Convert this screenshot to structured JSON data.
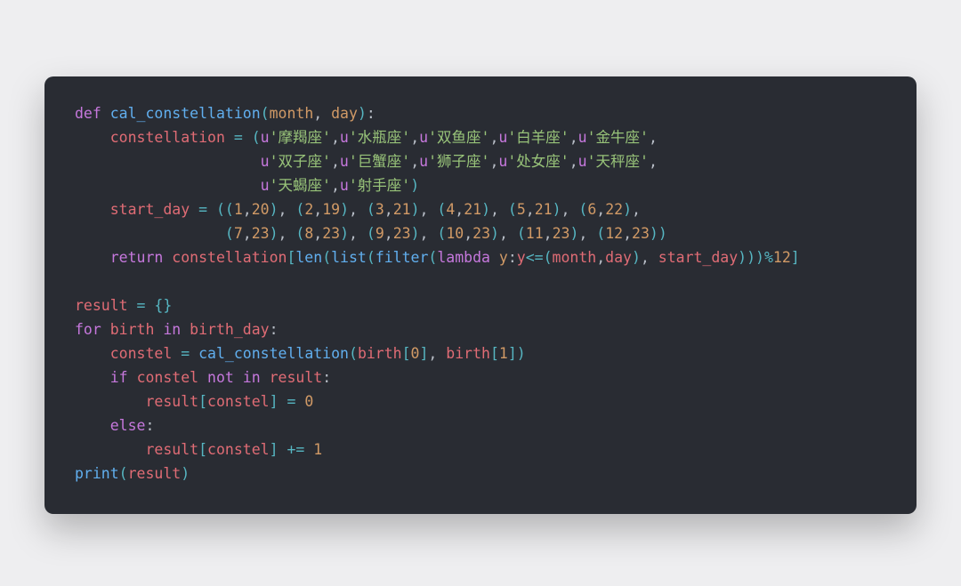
{
  "code": {
    "fn_def": "cal_constellation",
    "param_month": "month",
    "param_day": "day",
    "var_constellation": "constellation",
    "zodiac": [
      "摩羯座",
      "水瓶座",
      "双鱼座",
      "白羊座",
      "金牛座",
      "双子座",
      "巨蟹座",
      "狮子座",
      "处女座",
      "天秤座",
      "天蝎座",
      "射手座"
    ],
    "var_start_day": "start_day",
    "start_day_line1": [
      [
        1,
        20
      ],
      [
        2,
        19
      ],
      [
        3,
        21
      ],
      [
        4,
        21
      ],
      [
        5,
        21
      ],
      [
        6,
        22
      ]
    ],
    "start_day_line2": [
      [
        7,
        23
      ],
      [
        8,
        23
      ],
      [
        9,
        23
      ],
      [
        10,
        23
      ],
      [
        11,
        23
      ],
      [
        12,
        23
      ]
    ],
    "kw_def": "def",
    "kw_return": "return",
    "kw_for": "for",
    "kw_in": "in",
    "kw_if": "if",
    "kw_not": "not",
    "kw_else": "else",
    "kw_lambda": "lambda",
    "builtin_len": "len",
    "builtin_list": "list",
    "builtin_filter": "filter",
    "builtin_print": "print",
    "lambda_var": "y",
    "mod_value": "12",
    "var_result": "result",
    "var_birth": "birth",
    "var_birth_day": "birth_day",
    "var_constel": "constel",
    "idx0": "0",
    "idx1": "1",
    "assign_zero": "0",
    "inc_one": "1"
  }
}
